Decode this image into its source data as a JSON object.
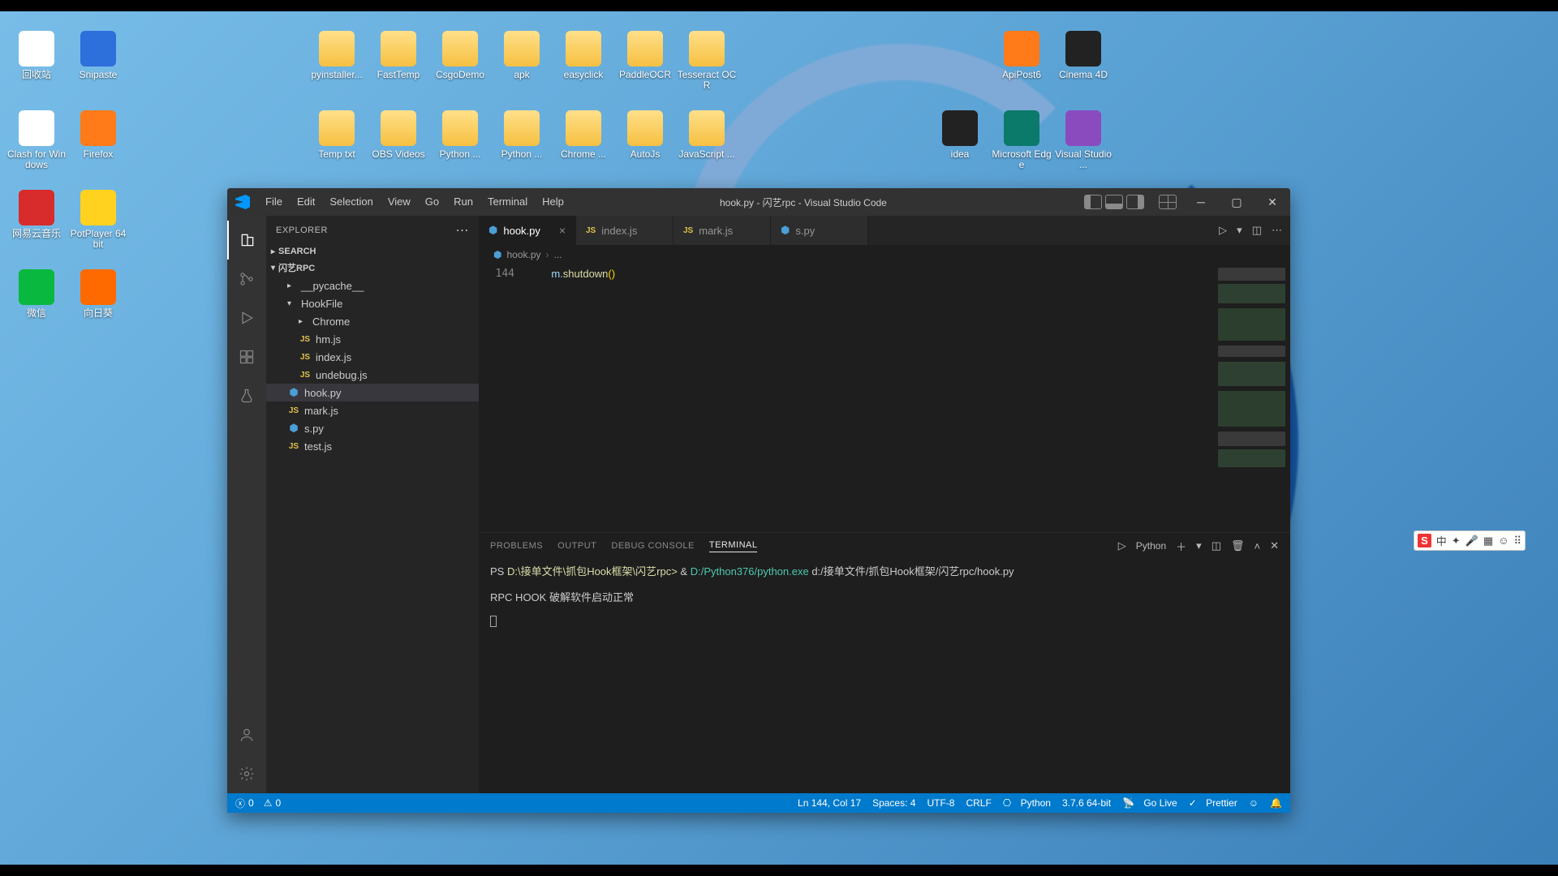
{
  "window_title": "hook.py - 闪艺rpc - Visual Studio Code",
  "menus": [
    "File",
    "Edit",
    "Selection",
    "View",
    "Go",
    "Run",
    "Terminal",
    "Help"
  ],
  "explorer": {
    "title": "EXPLORER",
    "search_label": "SEARCH",
    "project": "闪艺RPC",
    "tree": {
      "pycache": "__pycache__",
      "hookfile": "HookFile",
      "chrome": "Chrome",
      "hmjs": "hm.js",
      "indexjs": "index.js",
      "undebugjs": "undebug.js",
      "hookpy": "hook.py",
      "markjs": "mark.js",
      "spy": "s.py",
      "testjs": "test.js"
    }
  },
  "tabs": [
    {
      "icon": "py",
      "label": "hook.py",
      "active": true
    },
    {
      "icon": "js",
      "label": "index.js"
    },
    {
      "icon": "js",
      "label": "mark.js"
    },
    {
      "icon": "py",
      "label": "s.py"
    }
  ],
  "breadcrumb": {
    "file": "hook.py",
    "rest": "..."
  },
  "code": {
    "line_no": "144",
    "text_prefix": "m.",
    "text_call": "shutdown",
    "text_parens": "()"
  },
  "panel": {
    "tabs": {
      "problems": "PROBLEMS",
      "output": "OUTPUT",
      "debug": "DEBUG CONSOLE",
      "terminal": "TERMINAL"
    },
    "shell_label": "Python",
    "term_line1_ps": "PS ",
    "term_line1_path": "D:\\接单文件\\抓包Hook框架\\闪艺rpc> ",
    "term_line1_amp": "& ",
    "term_line1_exe": "D:/Python376/python.exe",
    "term_line1_arg": " d:/接单文件/抓包Hook框架/闪艺rpc/hook.py",
    "term_line2": "RPC HOOK 破解软件启动正常"
  },
  "status": {
    "errors": "0",
    "warnings": "0",
    "lncol": "Ln 144, Col 17",
    "spaces": "Spaces: 4",
    "enc": "UTF-8",
    "eol": "CRLF",
    "lang": "Python",
    "ver": "3.7.6 64-bit",
    "golive": "Go Live",
    "prettier": "Prettier"
  },
  "desktop_icons_col1": [
    {
      "label": "回收站",
      "kind": "app",
      "bg": "#fff"
    },
    {
      "label": "Clash for Windows",
      "kind": "app",
      "bg": "#fff"
    },
    {
      "label": "网易云音乐",
      "kind": "app",
      "bg": "#d82b2b"
    },
    {
      "label": "微信",
      "kind": "app",
      "bg": "#09b83e"
    }
  ],
  "desktop_icons_col2": [
    {
      "label": "Snipaste",
      "kind": "app",
      "bg": "#2d6fdb"
    },
    {
      "label": "Firefox",
      "kind": "app",
      "bg": "#ff7a18"
    },
    {
      "label": "PotPlayer 64 bit",
      "kind": "app",
      "bg": "#ffd21f"
    },
    {
      "label": "向日葵",
      "kind": "app",
      "bg": "#ff6a00"
    }
  ],
  "desktop_folders_row1": [
    "pyinstaller...",
    "FastTemp",
    "CsgoDemo",
    "apk",
    "easyclick",
    "PaddleOCR",
    "Tesseract OCR"
  ],
  "desktop_folders_row2": [
    "Temp txt",
    "OBS Videos",
    "Python ...",
    "Python ...",
    "Chrome ...",
    "AutoJs",
    "JavaScript ..."
  ],
  "desktop_apps_right_row1": [
    {
      "label": "ApiPost6",
      "bg": "#ff7a18"
    },
    {
      "label": "Cinema 4D",
      "bg": "#222"
    }
  ],
  "desktop_apps_right_row2": [
    {
      "label": "idea",
      "bg": "#222"
    },
    {
      "label": "Microsoft Edge",
      "bg": "#0b7a6b"
    },
    {
      "label": "Visual Studio ...",
      "bg": "#8a4bbf"
    }
  ],
  "ime": {
    "logo": "S",
    "items": [
      "中",
      "✦",
      "🎤",
      "▦",
      "☺",
      "⠿"
    ]
  }
}
